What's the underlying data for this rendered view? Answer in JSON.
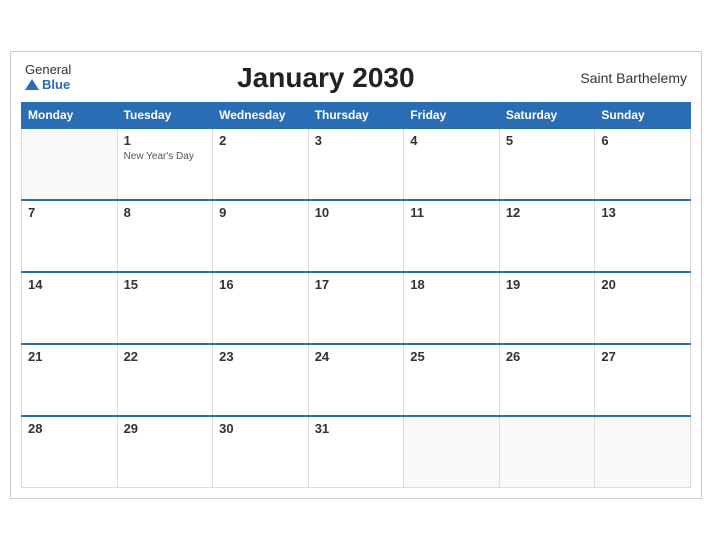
{
  "header": {
    "logo_general": "General",
    "logo_blue": "Blue",
    "title": "January 2030",
    "region": "Saint Barthelemy"
  },
  "days_of_week": [
    "Monday",
    "Tuesday",
    "Wednesday",
    "Thursday",
    "Friday",
    "Saturday",
    "Sunday"
  ],
  "weeks": [
    [
      {
        "day": "",
        "event": ""
      },
      {
        "day": "1",
        "event": "New Year's Day"
      },
      {
        "day": "2",
        "event": ""
      },
      {
        "day": "3",
        "event": ""
      },
      {
        "day": "4",
        "event": ""
      },
      {
        "day": "5",
        "event": ""
      },
      {
        "day": "6",
        "event": ""
      }
    ],
    [
      {
        "day": "7",
        "event": ""
      },
      {
        "day": "8",
        "event": ""
      },
      {
        "day": "9",
        "event": ""
      },
      {
        "day": "10",
        "event": ""
      },
      {
        "day": "11",
        "event": ""
      },
      {
        "day": "12",
        "event": ""
      },
      {
        "day": "13",
        "event": ""
      }
    ],
    [
      {
        "day": "14",
        "event": ""
      },
      {
        "day": "15",
        "event": ""
      },
      {
        "day": "16",
        "event": ""
      },
      {
        "day": "17",
        "event": ""
      },
      {
        "day": "18",
        "event": ""
      },
      {
        "day": "19",
        "event": ""
      },
      {
        "day": "20",
        "event": ""
      }
    ],
    [
      {
        "day": "21",
        "event": ""
      },
      {
        "day": "22",
        "event": ""
      },
      {
        "day": "23",
        "event": ""
      },
      {
        "day": "24",
        "event": ""
      },
      {
        "day": "25",
        "event": ""
      },
      {
        "day": "26",
        "event": ""
      },
      {
        "day": "27",
        "event": ""
      }
    ],
    [
      {
        "day": "28",
        "event": ""
      },
      {
        "day": "29",
        "event": ""
      },
      {
        "day": "30",
        "event": ""
      },
      {
        "day": "31",
        "event": ""
      },
      {
        "day": "",
        "event": ""
      },
      {
        "day": "",
        "event": ""
      },
      {
        "day": "",
        "event": ""
      }
    ]
  ]
}
